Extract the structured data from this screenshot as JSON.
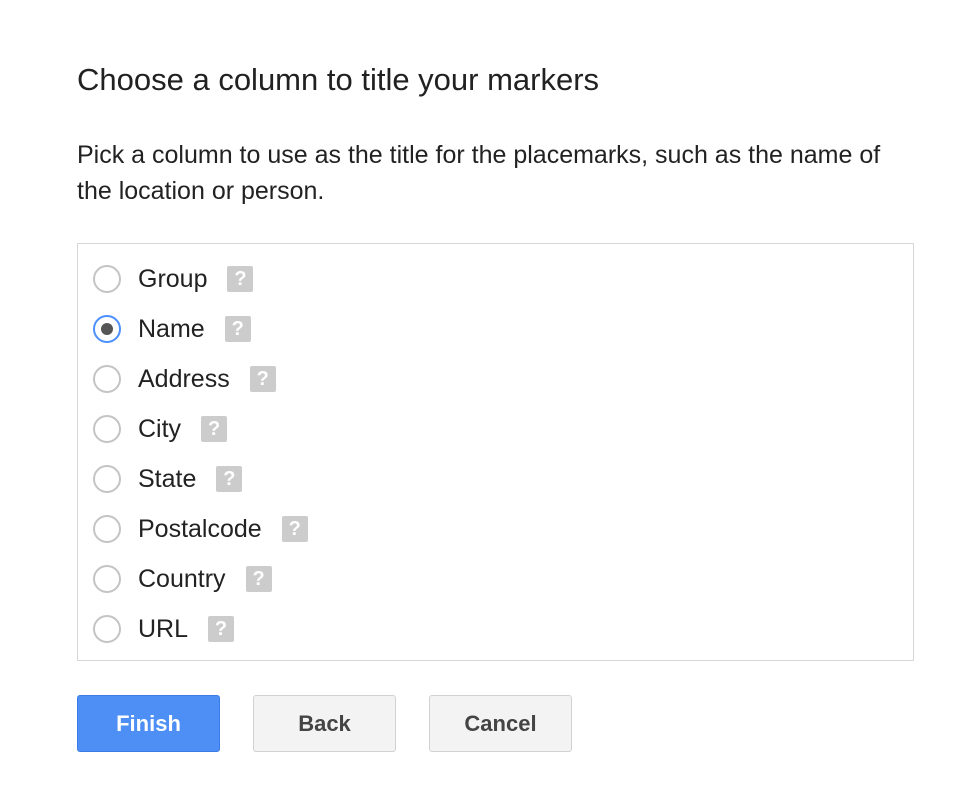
{
  "dialog": {
    "title": "Choose a column to title your markers",
    "description": "Pick a column to use as the title for the placemarks, such as the name of the location or person.",
    "selected_option": "Name",
    "options": [
      {
        "label": "Group",
        "help_icon": "help-icon",
        "help_glyph": "?"
      },
      {
        "label": "Name",
        "help_icon": "help-icon",
        "help_glyph": "?"
      },
      {
        "label": "Address",
        "help_icon": "help-icon",
        "help_glyph": "?"
      },
      {
        "label": "City",
        "help_icon": "help-icon",
        "help_glyph": "?"
      },
      {
        "label": "State",
        "help_icon": "help-icon",
        "help_glyph": "?"
      },
      {
        "label": "Postalcode",
        "help_icon": "help-icon",
        "help_glyph": "?"
      },
      {
        "label": "Country",
        "help_icon": "help-icon",
        "help_glyph": "?"
      },
      {
        "label": "URL",
        "help_icon": "help-icon",
        "help_glyph": "?"
      }
    ],
    "buttons": {
      "finish": "Finish",
      "back": "Back",
      "cancel": "Cancel"
    }
  },
  "colors": {
    "primary_button": "#4d8ff4",
    "radio_selected_ring": "#4d90fe",
    "help_icon_bg": "#cccccc"
  }
}
